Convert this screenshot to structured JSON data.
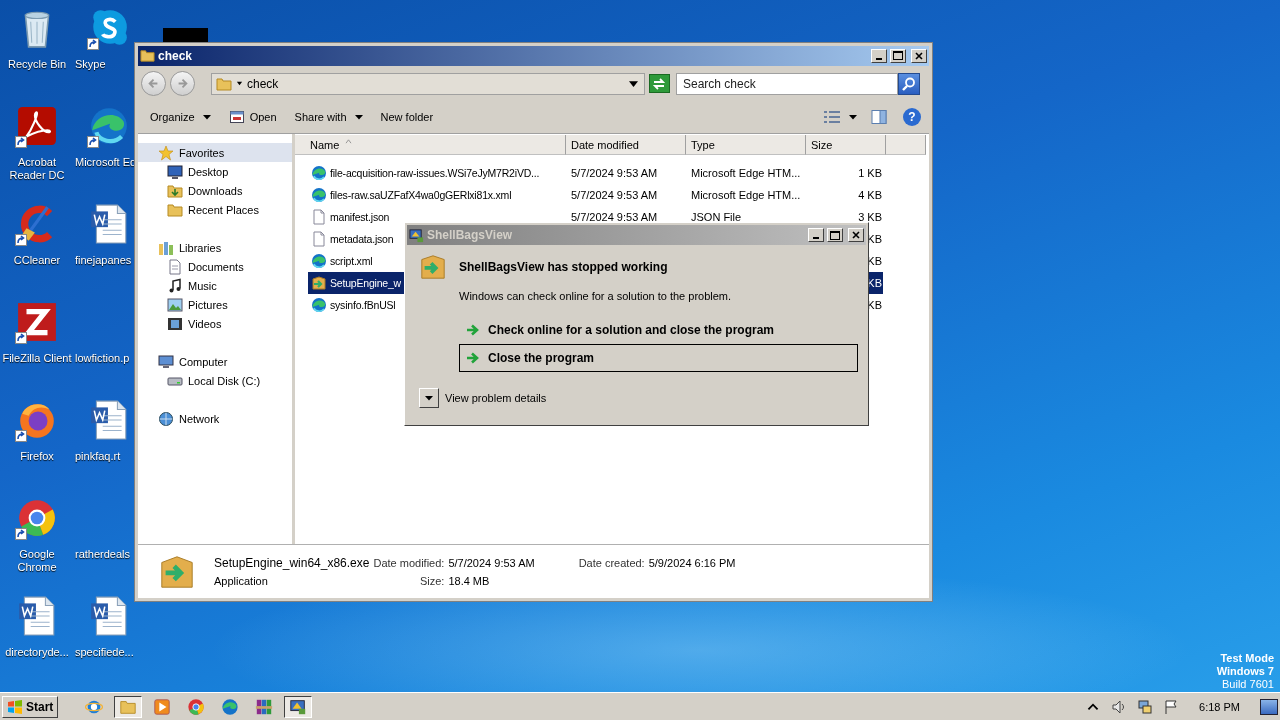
{
  "desktop": {
    "icons": [
      {
        "label": "Recycle Bin",
        "kind": "recycle-bin",
        "shortcut": false
      },
      {
        "label": "Skype",
        "kind": "skype",
        "shortcut": true
      },
      {
        "label": "Acrobat Reader DC",
        "kind": "acrobat",
        "shortcut": true
      },
      {
        "label": "Microsoft Ed",
        "kind": "edge",
        "shortcut": true
      },
      {
        "label": "CCleaner",
        "kind": "ccleaner",
        "shortcut": true
      },
      {
        "label": "finejapanes",
        "kind": "word",
        "shortcut": false
      },
      {
        "label": "FileZilla Client",
        "kind": "filezilla",
        "shortcut": true
      },
      {
        "label": "lowfiction.p",
        "kind": "blank",
        "shortcut": false
      },
      {
        "label": "Firefox",
        "kind": "firefox",
        "shortcut": true
      },
      {
        "label": "pinkfaq.rt",
        "kind": "word",
        "shortcut": false
      },
      {
        "label": "Google Chrome",
        "kind": "chrome",
        "shortcut": true
      },
      {
        "label": "ratherdeals",
        "kind": "blank",
        "shortcut": false
      },
      {
        "label": "directoryde...",
        "kind": "word",
        "shortcut": false
      },
      {
        "label": "specifiede...",
        "kind": "word",
        "shortcut": false
      }
    ]
  },
  "explorer": {
    "title": "check",
    "address": "check",
    "search": {
      "placeholder": "Search check"
    },
    "toolbar": [
      {
        "label": "Organize",
        "kind": "menu"
      },
      {
        "label": "Open",
        "kind": "open"
      },
      {
        "label": "Share with",
        "kind": "menu"
      },
      {
        "label": "New folder",
        "kind": "plain"
      }
    ],
    "help": "?",
    "nav": [
      {
        "label": "Favorites",
        "kind": "star",
        "selected": true,
        "children": [
          {
            "label": "Desktop",
            "kind": "monitor",
            "selected": false
          },
          {
            "label": "Downloads",
            "kind": "downloads",
            "selected": false
          },
          {
            "label": "Recent Places",
            "kind": "folder",
            "selected": false
          }
        ]
      },
      {
        "label": "Libraries",
        "kind": "library",
        "selected": false,
        "children": [
          {
            "label": "Documents",
            "kind": "page",
            "selected": false
          },
          {
            "label": "Music",
            "kind": "note",
            "selected": false
          },
          {
            "label": "Pictures",
            "kind": "frame",
            "selected": false
          },
          {
            "label": "Videos",
            "kind": "film",
            "selected": false
          }
        ]
      },
      {
        "label": "Computer",
        "kind": "computer",
        "selected": false,
        "children": [
          {
            "label": "Local Disk (C:)",
            "kind": "drive",
            "selected": false
          }
        ]
      },
      {
        "label": "Network",
        "kind": "globe",
        "selected": false
      }
    ],
    "columns": [
      {
        "label": "Name",
        "sorted": true
      },
      {
        "label": "Date modified",
        "sorted": false
      },
      {
        "label": "Type",
        "sorted": false
      },
      {
        "label": "Size",
        "sorted": false
      }
    ],
    "rows": [
      {
        "name": "file-acquisition-raw-issues.WSi7eJyM7R2iVD...",
        "date": "5/7/2024 9:53 AM",
        "type": "Microsoft Edge HTM...",
        "size": "1 KB",
        "kind": "edge",
        "selected": false
      },
      {
        "name": "files-raw.saUZFafX4wa0gGERlxi81x.xml",
        "date": "5/7/2024 9:53 AM",
        "type": "Microsoft Edge HTM...",
        "size": "4 KB",
        "kind": "edge",
        "selected": false
      },
      {
        "name": "manifest.json",
        "date": "5/7/2024 9:53 AM",
        "type": "JSON File",
        "size": "3 KB",
        "kind": "page",
        "selected": false
      },
      {
        "name": "metadata.json",
        "size": "KB",
        "kind": "page",
        "selected": false
      },
      {
        "name": "script.xml",
        "size": "KB",
        "kind": "edge",
        "selected": false
      },
      {
        "name": "SetupEngine_w",
        "size": "KB",
        "kind": "installer",
        "selected": true
      },
      {
        "name": "sysinfo.fBnUSl",
        "size": "KB",
        "kind": "edge",
        "selected": false
      }
    ],
    "details": {
      "name": "SetupEngine_win64_x86.exe",
      "type": "Application",
      "fields": [
        {
          "label": "Date modified:",
          "value": "5/7/2024 9:53 AM"
        },
        {
          "label": "Date created:",
          "value": "5/9/2024 6:16 PM"
        },
        {
          "label": "Size:",
          "value": "18.4 MB"
        }
      ]
    }
  },
  "dialog": {
    "title": "ShellBagsView",
    "heading": "ShellBagsView has stopped working",
    "message": "Windows can check online for a solution to the problem.",
    "options": [
      {
        "label": "Check online for a solution and close the program",
        "selected": false
      },
      {
        "label": "Close the program",
        "selected": true
      }
    ],
    "details_toggle": "View problem details"
  },
  "taskbar": {
    "start": "Start",
    "apps": [
      {
        "kind": "ie",
        "active": false
      },
      {
        "kind": "explorer",
        "active": true
      },
      {
        "kind": "media",
        "active": false
      },
      {
        "kind": "chrome",
        "active": false
      },
      {
        "kind": "edge",
        "active": false
      },
      {
        "kind": "winrar",
        "active": false
      },
      {
        "kind": "shellbags",
        "active": true
      }
    ],
    "clock": "6:18 PM"
  },
  "system_notice": [
    "Test Mode",
    "Windows 7",
    "Build 7601"
  ]
}
